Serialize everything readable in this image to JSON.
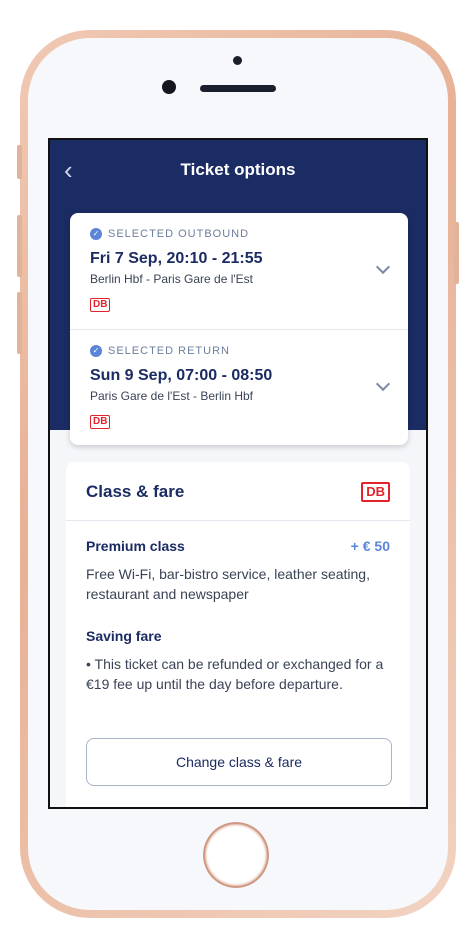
{
  "header": {
    "back_icon": "chevron-left-icon",
    "title": "Ticket options"
  },
  "outbound": {
    "status": "SELECTED OUTBOUND",
    "time": "Fri 7 Sep, 20:10 - 21:55",
    "route": "Berlin Hbf  -  Paris Gare de l'Est",
    "operator": "DB"
  },
  "return": {
    "status": "SELECTED RETURN",
    "time": "Sun 9 Sep, 07:00 - 08:50",
    "route": "Paris Gare de l'Est  -  Berlin Hbf",
    "operator": "DB"
  },
  "fare": {
    "title": "Class & fare",
    "operator": "DB",
    "class_name": "Premium class",
    "class_price": "+ € 50",
    "class_desc": "Free Wi-Fi, bar-bistro service, leather seating, restaurant and newspaper",
    "saving_title": "Saving fare",
    "saving_desc": "• This ticket can be refunded or exchanged for a €19 fee up until the day before departure.",
    "change_button": "Change class & fare"
  },
  "colors": {
    "navy": "#1b2b63",
    "accent": "#5b85d8",
    "db_red": "#e3232b"
  }
}
